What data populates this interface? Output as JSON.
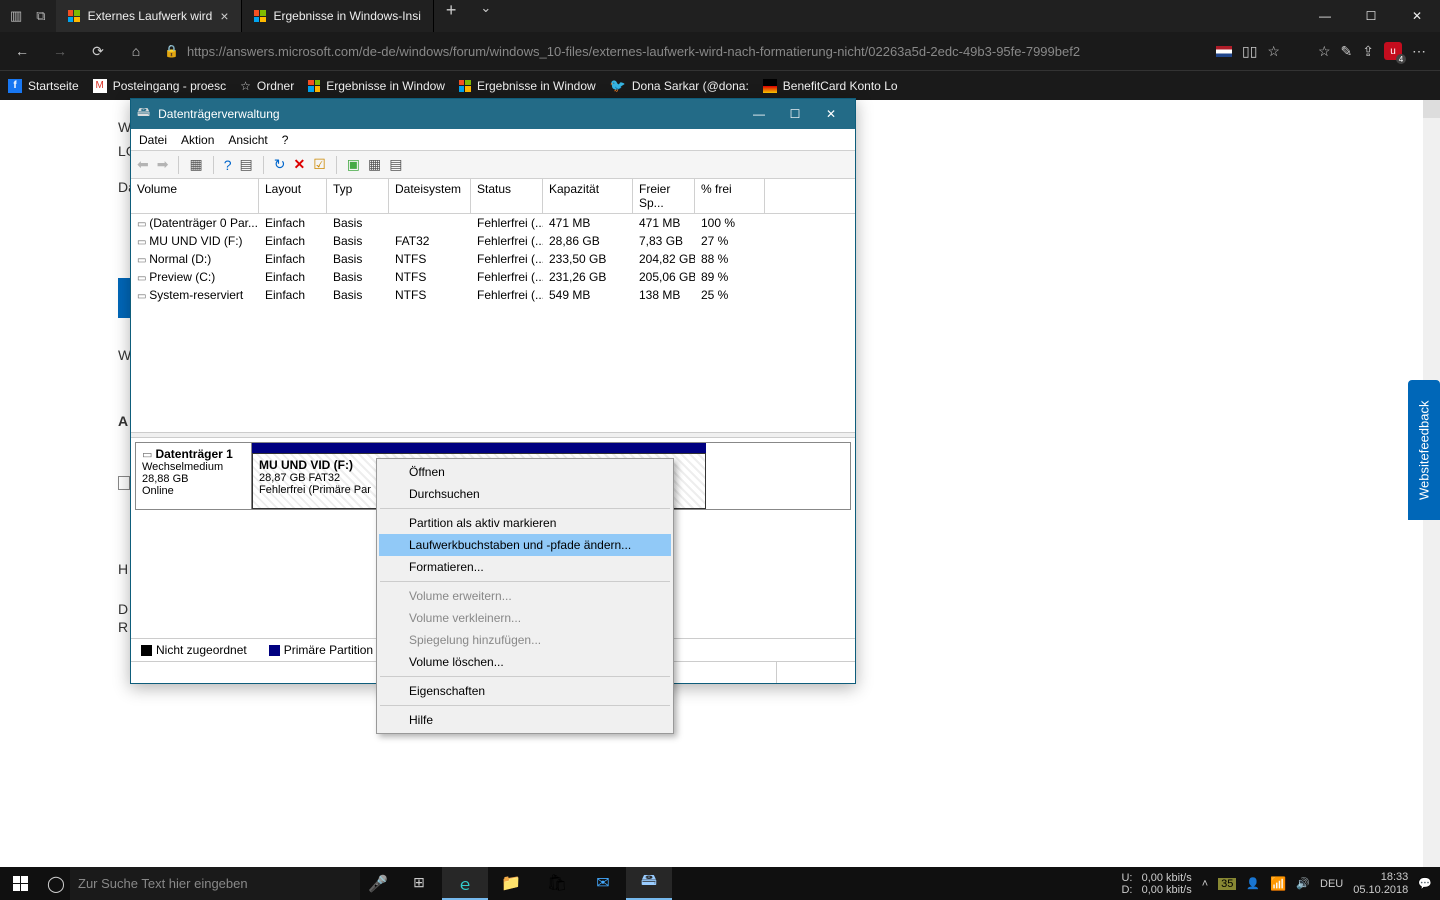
{
  "browser": {
    "tabs": [
      {
        "title": "Externes Laufwerk wird",
        "active": true
      },
      {
        "title": "Ergebnisse in Windows-Insi",
        "active": false
      }
    ],
    "url": "https://answers.microsoft.com/de-de/windows/forum/windows_10-files/externes-laufwerk-wird-nach-formatierung-nicht/02263a5d-2edc-49b3-95fe-7999bef2",
    "bookmarks": [
      {
        "label": "Startseite",
        "icon": "fb"
      },
      {
        "label": "Posteingang - proesc",
        "icon": "gm"
      },
      {
        "label": "Ordner",
        "icon": "star"
      },
      {
        "label": "Ergebnisse in Window",
        "icon": "ms"
      },
      {
        "label": "Ergebnisse in Window",
        "icon": "ms"
      },
      {
        "label": "Dona Sarkar (@dona:",
        "icon": "tw"
      },
      {
        "label": "BenefitCard Konto Lo",
        "icon": "bc"
      }
    ]
  },
  "dm": {
    "title": "Datenträgerverwaltung",
    "menu": [
      "Datei",
      "Aktion",
      "Ansicht",
      "?"
    ],
    "columns": [
      "Volume",
      "Layout",
      "Typ",
      "Dateisystem",
      "Status",
      "Kapazität",
      "Freier Sp...",
      "% frei"
    ],
    "rows": [
      {
        "volume": "(Datenträger 0 Par...",
        "layout": "Einfach",
        "typ": "Basis",
        "fs": "",
        "status": "Fehlerfrei (...",
        "cap": "471 MB",
        "free": "471 MB",
        "pct": "100 %"
      },
      {
        "volume": "MU UND VID (F:)",
        "layout": "Einfach",
        "typ": "Basis",
        "fs": "FAT32",
        "status": "Fehlerfrei (...",
        "cap": "28,86 GB",
        "free": "7,83 GB",
        "pct": "27 %"
      },
      {
        "volume": "Normal (D:)",
        "layout": "Einfach",
        "typ": "Basis",
        "fs": "NTFS",
        "status": "Fehlerfrei (...",
        "cap": "233,50 GB",
        "free": "204,82 GB",
        "pct": "88 %"
      },
      {
        "volume": "Preview (C:)",
        "layout": "Einfach",
        "typ": "Basis",
        "fs": "NTFS",
        "status": "Fehlerfrei (...",
        "cap": "231,26 GB",
        "free": "205,06 GB",
        "pct": "89 %"
      },
      {
        "volume": "System-reserviert",
        "layout": "Einfach",
        "typ": "Basis",
        "fs": "NTFS",
        "status": "Fehlerfrei (...",
        "cap": "549 MB",
        "free": "138 MB",
        "pct": "25 %"
      }
    ],
    "disk": {
      "name": "Datenträger 1",
      "type": "Wechselmedium",
      "size": "28,88 GB",
      "status": "Online",
      "partition": {
        "name": "MU UND VID  (F:)",
        "info": "28,87 GB FAT32",
        "state": "Fehlerfrei (Primäre Par"
      }
    },
    "legend": {
      "unalloc": "Nicht zugeordnet",
      "primary": "Primäre Partition"
    }
  },
  "ctx": {
    "open": "Öffnen",
    "browse": "Durchsuchen",
    "active": "Partition als aktiv markieren",
    "change": "Laufwerkbuchstaben und -pfade ändern...",
    "format": "Formatieren...",
    "extend": "Volume erweitern...",
    "shrink": "Volume verkleinern...",
    "mirror": "Spiegelung hinzufügen...",
    "delete": "Volume löschen...",
    "props": "Eigenschaften",
    "help": "Hilfe"
  },
  "feedback": "Websitefeedback",
  "taskbar": {
    "search_placeholder": "Zur Suche Text hier eingeben",
    "net_up_label": "U:",
    "net_down_label": "D:",
    "net_up": "0,00 kbit/s",
    "net_down": "0,00 kbit/s",
    "temp": "35",
    "lang": "DEU",
    "time": "18:33",
    "date": "05.10.2018"
  },
  "page_letters": {
    "w": "W",
    "lg": "LG",
    "da": "Da",
    "w2": "W",
    "a": "A",
    "h": "H",
    "d": "D",
    "r": "R"
  }
}
